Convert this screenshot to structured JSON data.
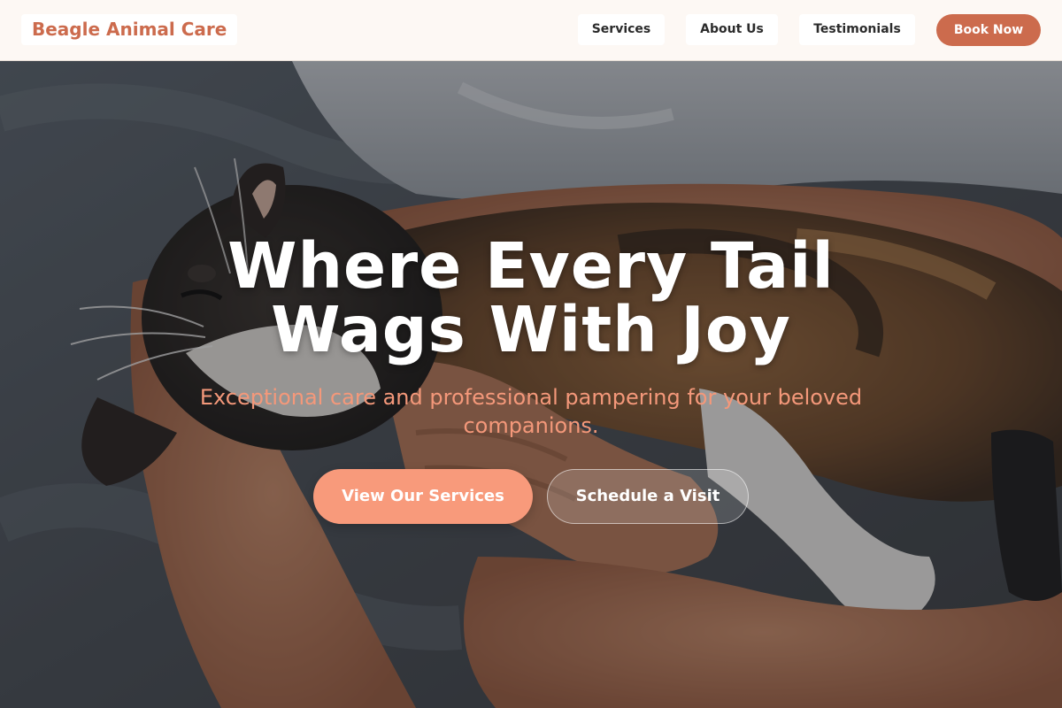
{
  "nav": {
    "brand": "Beagle Animal Care",
    "links": [
      {
        "label": "Services"
      },
      {
        "label": "About Us"
      },
      {
        "label": "Testimonials"
      }
    ],
    "cta_label": "Book Now"
  },
  "hero": {
    "image": "cat-held-in-arms-photo",
    "headline_line1": "Where Every Tail",
    "headline_line2": "Wags With Joy",
    "subtitle": "Exceptional care and professional pampering for your beloved companions.",
    "primary_button": "View Our Services",
    "secondary_button": "Schedule a Visit"
  },
  "colors": {
    "brand": "#cc6b4d",
    "accent": "#f89a7b",
    "nav_background": "#fdf8f4"
  }
}
